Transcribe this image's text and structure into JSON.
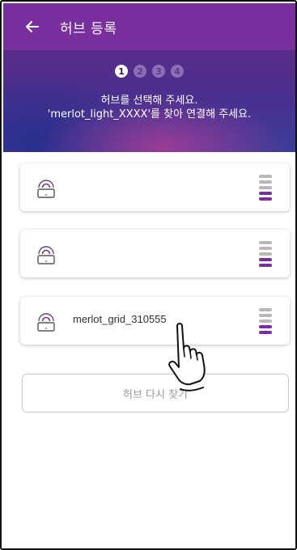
{
  "header": {
    "title": "허브 등록",
    "back_icon": "back-arrow-icon"
  },
  "steps": {
    "items": [
      "1",
      "2",
      "3",
      "4"
    ],
    "active_index": 0
  },
  "instructions": {
    "line1": "허브를 선택해 주세요.",
    "line2": "'merlot_light_XXXX'를 찾아 연결해 주세요."
  },
  "hubs": [
    {
      "name": "",
      "icon": "hub-device-icon",
      "signal_icon": "signal-strength-icon"
    },
    {
      "name": "",
      "icon": "hub-device-icon",
      "signal_icon": "signal-strength-icon"
    },
    {
      "name": "merlot_grid_310555",
      "icon": "hub-device-icon",
      "signal_icon": "signal-strength-icon"
    }
  ],
  "retry_button": {
    "label": "허브 다시 찾기"
  },
  "colors": {
    "header": "#7a2f9e",
    "accent": "#7a2f9e",
    "signal_inactive": "#b8b8b8"
  },
  "overlay": {
    "icon": "pointing-hand-cursor-icon"
  }
}
